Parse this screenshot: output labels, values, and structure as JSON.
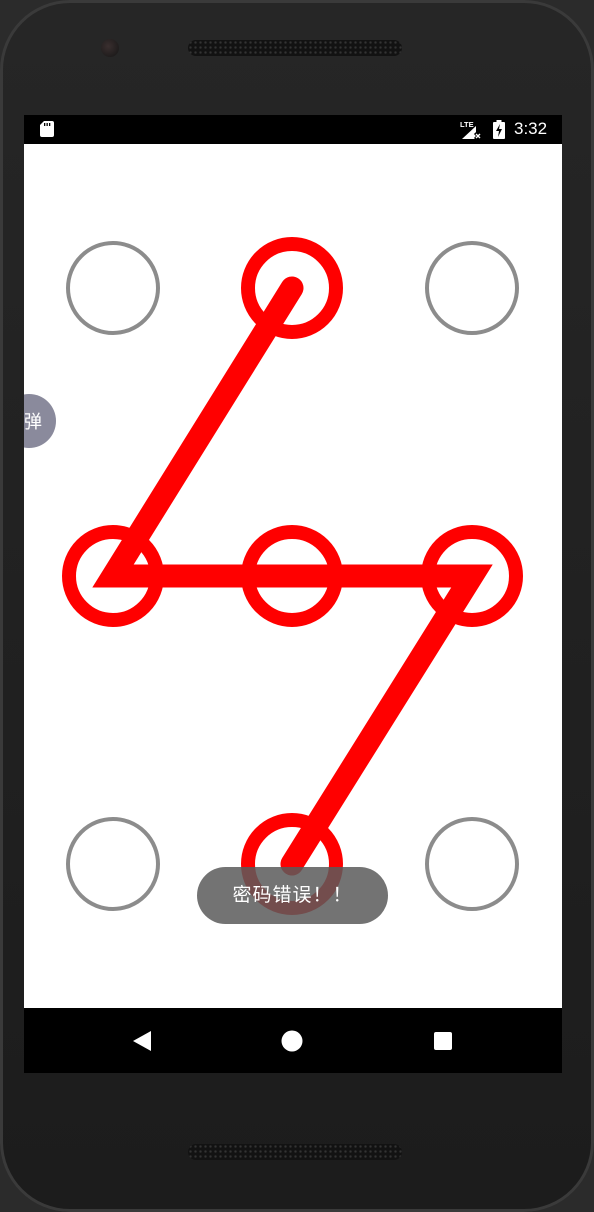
{
  "status_bar": {
    "time": "3:32",
    "network_label": "LTE",
    "icons": [
      "sd-card-icon",
      "signal-icon",
      "battery-charging-icon"
    ]
  },
  "pattern_lock": {
    "grid": [
      [
        "idle",
        "selected",
        "idle"
      ],
      [
        "selected",
        "selected",
        "selected"
      ],
      [
        "idle",
        "selected",
        "idle"
      ]
    ],
    "path": [
      [
        0,
        1
      ],
      [
        1,
        0
      ],
      [
        1,
        1
      ],
      [
        1,
        2
      ],
      [
        2,
        1
      ]
    ],
    "colors": {
      "idle": "#8c8c8c",
      "selected": "#ff0000",
      "line": "#ff0000"
    }
  },
  "floating_button": {
    "label": "弹"
  },
  "toast": {
    "message": "密码错误！！"
  },
  "nav_bar": {
    "buttons": [
      "back",
      "home",
      "recents"
    ]
  }
}
